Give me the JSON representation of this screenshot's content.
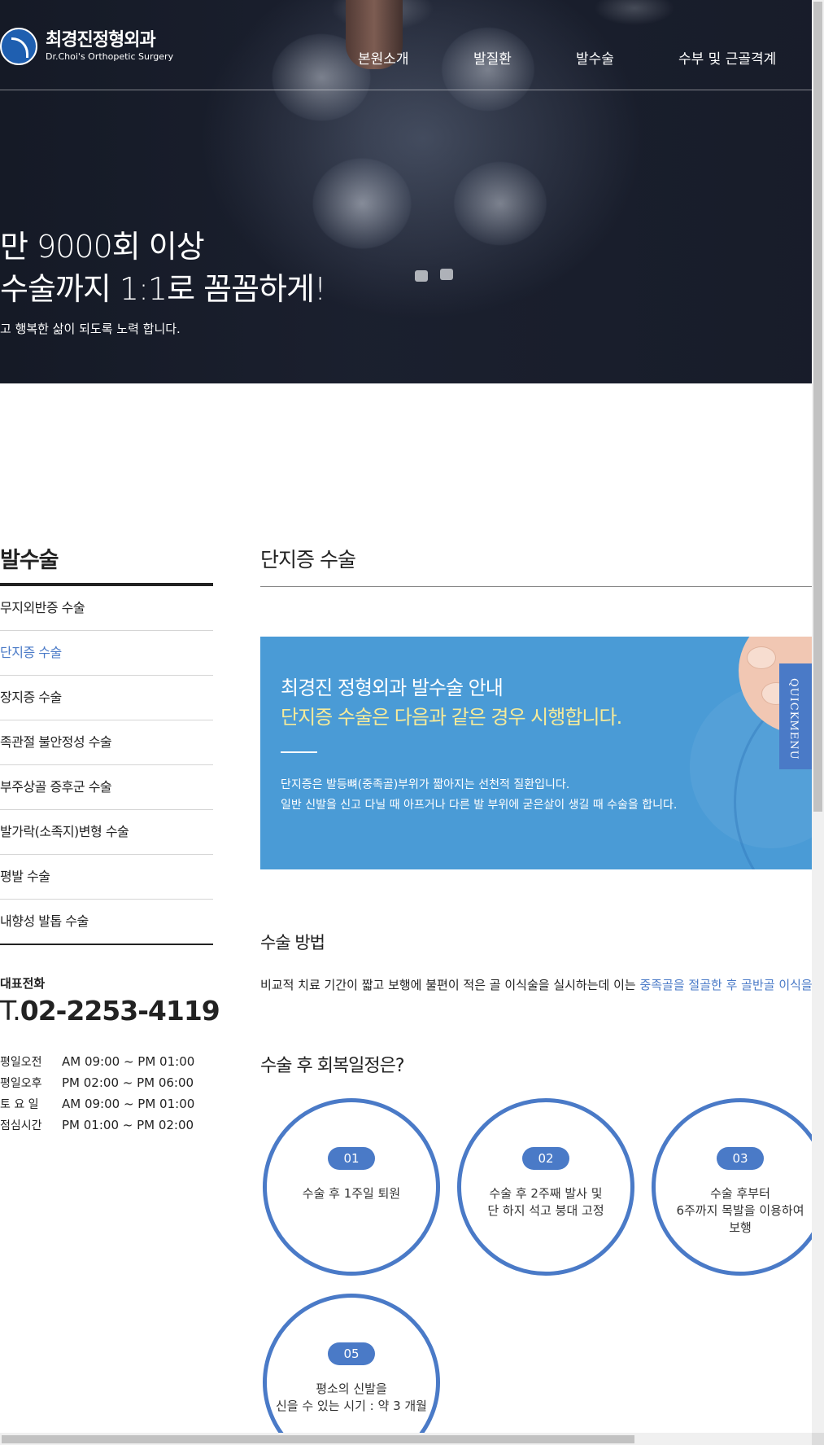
{
  "brand": {
    "name_ko": "최경진정형외과",
    "name_en": "Dr.Choi's Orthopetic Surgery",
    "accent_color": "#4a7ac7",
    "box_color": "#4a9bd6"
  },
  "nav": [
    "본원소개",
    "발질환",
    "발수술",
    "수부 및 근골격계"
  ],
  "hero": {
    "line1": "만 9000회 이상",
    "line2": "수술까지 1:1로 꼼꼼하게!",
    "sub": "고 행복한 삶이 되도록 노력 합니다."
  },
  "sidebar": {
    "title": "발수술",
    "items": [
      {
        "label": "무지외반증 수술"
      },
      {
        "label": "단지증 수술"
      },
      {
        "label": "장지증 수술"
      },
      {
        "label": "족관절 불안정성 수술"
      },
      {
        "label": "부주상골 증후군 수술"
      },
      {
        "label": "발가락(소족지)변형 수술"
      },
      {
        "label": "평발 수술"
      },
      {
        "label": "내향성 발톱 수술"
      }
    ],
    "active_index": 1,
    "tel_label": "대표전화",
    "tel_prefix": "T.",
    "tel_number": "02-2253-4119",
    "hours": [
      {
        "day": "평일오전",
        "time": "AM 09:00 ~ PM 01:00"
      },
      {
        "day": "평일오후",
        "time": "PM 02:00 ~ PM 06:00"
      },
      {
        "day": "토 요 일",
        "time": "AM 09:00 ~ PM 01:00"
      },
      {
        "day": "점심시간",
        "time": "PM 01:00 ~ PM 02:00"
      }
    ]
  },
  "main": {
    "title": "단지증 수술",
    "info_title1": "최경진 정형외과 발수술 안내",
    "info_title2": "단지증 수술은 다음과 같은 경우 시행합니다.",
    "info_p1": "단지증은 발등뼈(중족골)부위가 짧아지는 선천적 질환입니다.",
    "info_p2": "일반 신발을 신고 다닐 때 아프거나 다른 발 부위에 굳은살이 생길 때 수술을 합니다.",
    "method_heading": "수술 방법",
    "method_text": "비교적 치료 기간이 짧고 보행에 불편이 적은 골 이식술을 실시하는데 이는 ",
    "method_highlight": "중족골을 절골한 후 골반골 이식을",
    "recovery_heading": "수술 후 회복일정은?",
    "steps": [
      {
        "num": "01",
        "text": "수술 후 1주일 퇴원"
      },
      {
        "num": "02",
        "text": "수술 후 2주째 발사 및\n단 하지 석고 붕대 고정"
      },
      {
        "num": "03",
        "text": "수술 후부터\n6주까지 목발을 이용하여\n보행"
      },
      {
        "num": "05",
        "text": "평소의 신발을\n신을 수 있는 시기 : 약 3 개월"
      }
    ]
  },
  "quickmenu": "QUICKMENU"
}
